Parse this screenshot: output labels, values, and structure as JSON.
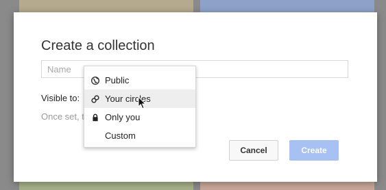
{
  "dialog": {
    "title": "Create a collection",
    "name_placeholder": "Name",
    "visible_label": "Visible to:",
    "hint": "Once set, t",
    "cancel_label": "Cancel",
    "create_label": "Create"
  },
  "menu": {
    "items": [
      {
        "label": "Public",
        "icon": "globe-icon"
      },
      {
        "label": "Your circles",
        "icon": "circles-icon",
        "hovered": true
      },
      {
        "label": "Only you",
        "icon": "lock-icon"
      },
      {
        "label": "Custom",
        "icon": ""
      }
    ]
  },
  "colors": {
    "create_button": "#a6c1f2",
    "hover_row": "#eeeeee"
  }
}
